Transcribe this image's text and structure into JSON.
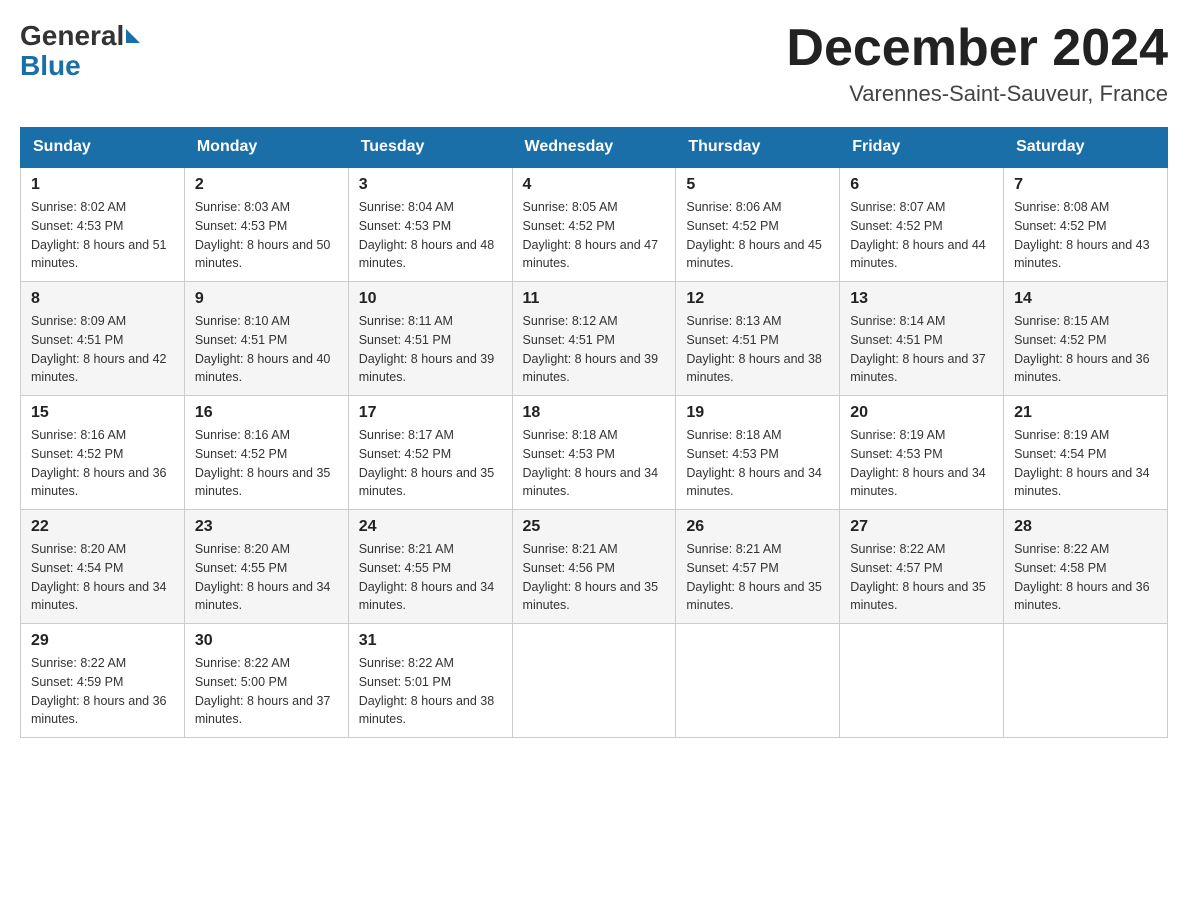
{
  "header": {
    "logo_general": "General",
    "logo_blue": "Blue",
    "month_year": "December 2024",
    "location": "Varennes-Saint-Sauveur, France"
  },
  "days_of_week": [
    "Sunday",
    "Monday",
    "Tuesday",
    "Wednesday",
    "Thursday",
    "Friday",
    "Saturday"
  ],
  "weeks": [
    [
      {
        "day": "1",
        "sunrise": "8:02 AM",
        "sunset": "4:53 PM",
        "daylight": "8 hours and 51 minutes."
      },
      {
        "day": "2",
        "sunrise": "8:03 AM",
        "sunset": "4:53 PM",
        "daylight": "8 hours and 50 minutes."
      },
      {
        "day": "3",
        "sunrise": "8:04 AM",
        "sunset": "4:53 PM",
        "daylight": "8 hours and 48 minutes."
      },
      {
        "day": "4",
        "sunrise": "8:05 AM",
        "sunset": "4:52 PM",
        "daylight": "8 hours and 47 minutes."
      },
      {
        "day": "5",
        "sunrise": "8:06 AM",
        "sunset": "4:52 PM",
        "daylight": "8 hours and 45 minutes."
      },
      {
        "day": "6",
        "sunrise": "8:07 AM",
        "sunset": "4:52 PM",
        "daylight": "8 hours and 44 minutes."
      },
      {
        "day": "7",
        "sunrise": "8:08 AM",
        "sunset": "4:52 PM",
        "daylight": "8 hours and 43 minutes."
      }
    ],
    [
      {
        "day": "8",
        "sunrise": "8:09 AM",
        "sunset": "4:51 PM",
        "daylight": "8 hours and 42 minutes."
      },
      {
        "day": "9",
        "sunrise": "8:10 AM",
        "sunset": "4:51 PM",
        "daylight": "8 hours and 40 minutes."
      },
      {
        "day": "10",
        "sunrise": "8:11 AM",
        "sunset": "4:51 PM",
        "daylight": "8 hours and 39 minutes."
      },
      {
        "day": "11",
        "sunrise": "8:12 AM",
        "sunset": "4:51 PM",
        "daylight": "8 hours and 39 minutes."
      },
      {
        "day": "12",
        "sunrise": "8:13 AM",
        "sunset": "4:51 PM",
        "daylight": "8 hours and 38 minutes."
      },
      {
        "day": "13",
        "sunrise": "8:14 AM",
        "sunset": "4:51 PM",
        "daylight": "8 hours and 37 minutes."
      },
      {
        "day": "14",
        "sunrise": "8:15 AM",
        "sunset": "4:52 PM",
        "daylight": "8 hours and 36 minutes."
      }
    ],
    [
      {
        "day": "15",
        "sunrise": "8:16 AM",
        "sunset": "4:52 PM",
        "daylight": "8 hours and 36 minutes."
      },
      {
        "day": "16",
        "sunrise": "8:16 AM",
        "sunset": "4:52 PM",
        "daylight": "8 hours and 35 minutes."
      },
      {
        "day": "17",
        "sunrise": "8:17 AM",
        "sunset": "4:52 PM",
        "daylight": "8 hours and 35 minutes."
      },
      {
        "day": "18",
        "sunrise": "8:18 AM",
        "sunset": "4:53 PM",
        "daylight": "8 hours and 34 minutes."
      },
      {
        "day": "19",
        "sunrise": "8:18 AM",
        "sunset": "4:53 PM",
        "daylight": "8 hours and 34 minutes."
      },
      {
        "day": "20",
        "sunrise": "8:19 AM",
        "sunset": "4:53 PM",
        "daylight": "8 hours and 34 minutes."
      },
      {
        "day": "21",
        "sunrise": "8:19 AM",
        "sunset": "4:54 PM",
        "daylight": "8 hours and 34 minutes."
      }
    ],
    [
      {
        "day": "22",
        "sunrise": "8:20 AM",
        "sunset": "4:54 PM",
        "daylight": "8 hours and 34 minutes."
      },
      {
        "day": "23",
        "sunrise": "8:20 AM",
        "sunset": "4:55 PM",
        "daylight": "8 hours and 34 minutes."
      },
      {
        "day": "24",
        "sunrise": "8:21 AM",
        "sunset": "4:55 PM",
        "daylight": "8 hours and 34 minutes."
      },
      {
        "day": "25",
        "sunrise": "8:21 AM",
        "sunset": "4:56 PM",
        "daylight": "8 hours and 35 minutes."
      },
      {
        "day": "26",
        "sunrise": "8:21 AM",
        "sunset": "4:57 PM",
        "daylight": "8 hours and 35 minutes."
      },
      {
        "day": "27",
        "sunrise": "8:22 AM",
        "sunset": "4:57 PM",
        "daylight": "8 hours and 35 minutes."
      },
      {
        "day": "28",
        "sunrise": "8:22 AM",
        "sunset": "4:58 PM",
        "daylight": "8 hours and 36 minutes."
      }
    ],
    [
      {
        "day": "29",
        "sunrise": "8:22 AM",
        "sunset": "4:59 PM",
        "daylight": "8 hours and 36 minutes."
      },
      {
        "day": "30",
        "sunrise": "8:22 AM",
        "sunset": "5:00 PM",
        "daylight": "8 hours and 37 minutes."
      },
      {
        "day": "31",
        "sunrise": "8:22 AM",
        "sunset": "5:01 PM",
        "daylight": "8 hours and 38 minutes."
      },
      null,
      null,
      null,
      null
    ]
  ]
}
